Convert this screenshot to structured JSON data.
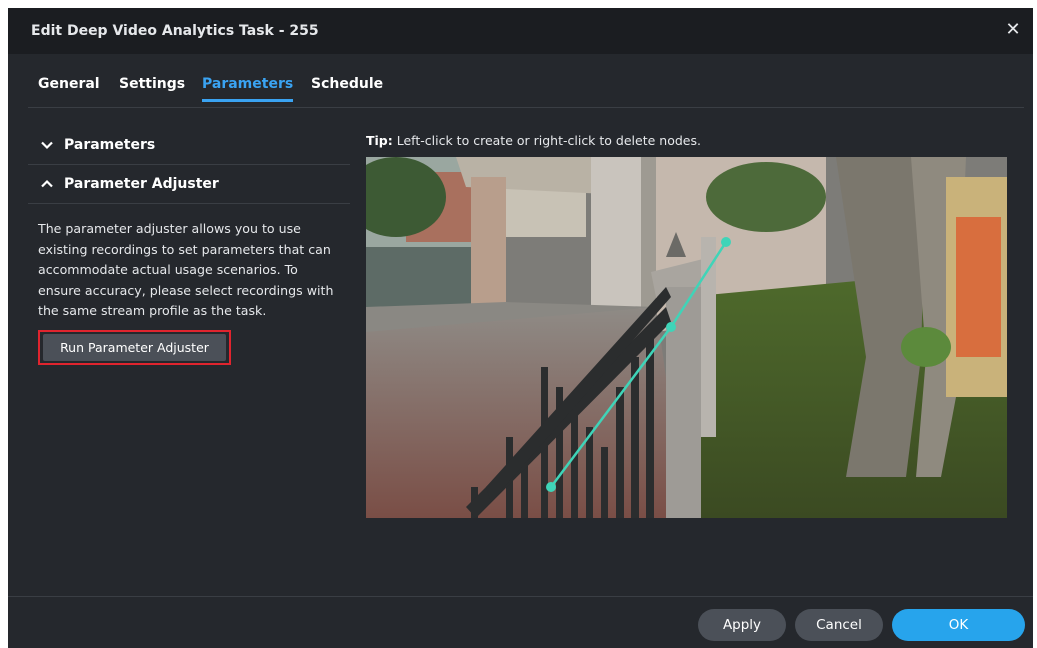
{
  "dialog": {
    "title": "Edit Deep Video Analytics Task - 255",
    "close_icon": "close-icon"
  },
  "tabs": [
    {
      "label": "General",
      "active": false
    },
    {
      "label": "Settings",
      "active": false
    },
    {
      "label": "Parameters",
      "active": true
    },
    {
      "label": "Schedule",
      "active": false
    }
  ],
  "left": {
    "parameters_header": "Parameters",
    "adjuster_header": "Parameter Adjuster",
    "description": "The parameter adjuster allows you to use existing recordings to set parameters that can accommodate actual usage scenarios. To ensure accuracy, please select recordings with the same stream profile as the task.",
    "run_button": "Run Parameter Adjuster"
  },
  "tip": {
    "label": "Tip:",
    "text": "Left-click to create or right-click to delete nodes."
  },
  "video": {
    "line_color": "#3fd4b8"
  },
  "footer": {
    "apply": "Apply",
    "cancel": "Cancel",
    "ok": "OK"
  },
  "colors": {
    "accent": "#3aa3f2",
    "ok_button": "#27a4ec",
    "highlight_border": "#e0242e"
  }
}
